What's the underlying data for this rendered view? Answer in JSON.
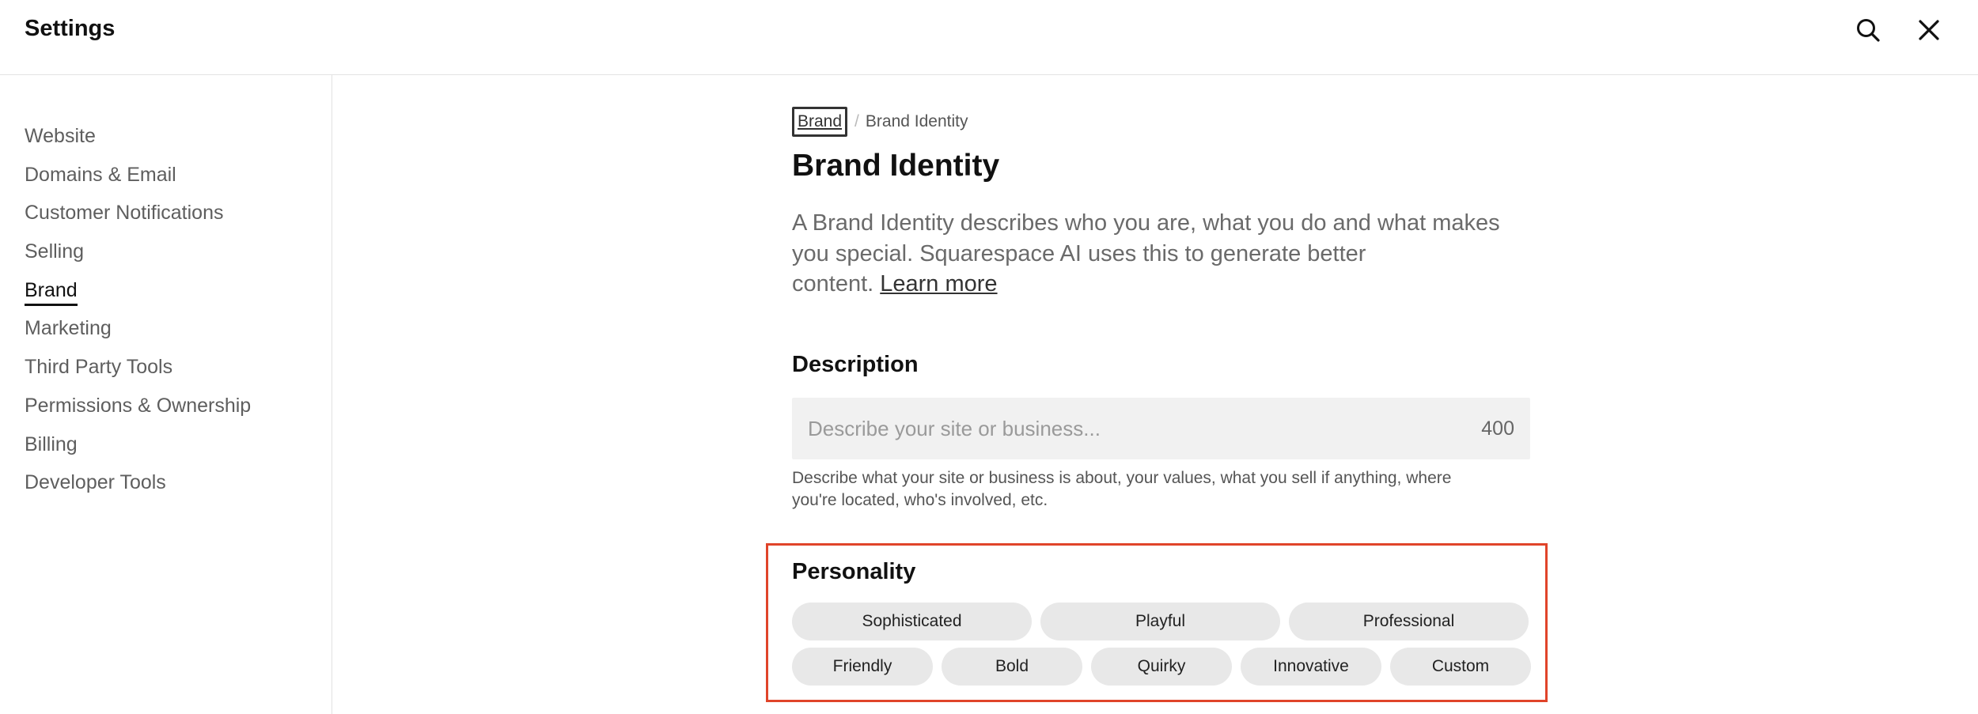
{
  "header": {
    "title": "Settings",
    "icons": [
      "search-icon",
      "close-icon"
    ]
  },
  "sidebar": {
    "items": [
      {
        "label": "Website"
      },
      {
        "label": "Domains & Email"
      },
      {
        "label": "Customer Notifications"
      },
      {
        "label": "Selling"
      },
      {
        "label": "Brand",
        "active": true
      },
      {
        "label": "Marketing"
      },
      {
        "label": "Third Party Tools"
      },
      {
        "label": "Permissions & Ownership"
      },
      {
        "label": "Billing"
      },
      {
        "label": "Developer Tools"
      }
    ]
  },
  "main": {
    "breadcrumb": {
      "parent": "Brand",
      "separator": "/",
      "current": "Brand Identity"
    },
    "title": "Brand Identity",
    "intro": {
      "line1": "A Brand Identity describes who you are, what you do and what makes",
      "line2": "you special. Squarespace AI uses this to generate better",
      "line3": "content.",
      "learn_more": "Learn more"
    },
    "description": {
      "title": "Description",
      "placeholder": "Describe your site or business...",
      "char_count": "400",
      "help_line1": "Describe what your site or business is about, your values, what you sell if anything, where",
      "help_line2": "you're located, who's involved, etc."
    },
    "personality": {
      "title": "Personality",
      "row1": [
        "Sophisticated",
        "Playful",
        "Professional"
      ],
      "row2": [
        "Friendly",
        "Bold",
        "Quirky",
        "Innovative",
        "Custom"
      ],
      "highlight_color": "#e0442a"
    }
  }
}
